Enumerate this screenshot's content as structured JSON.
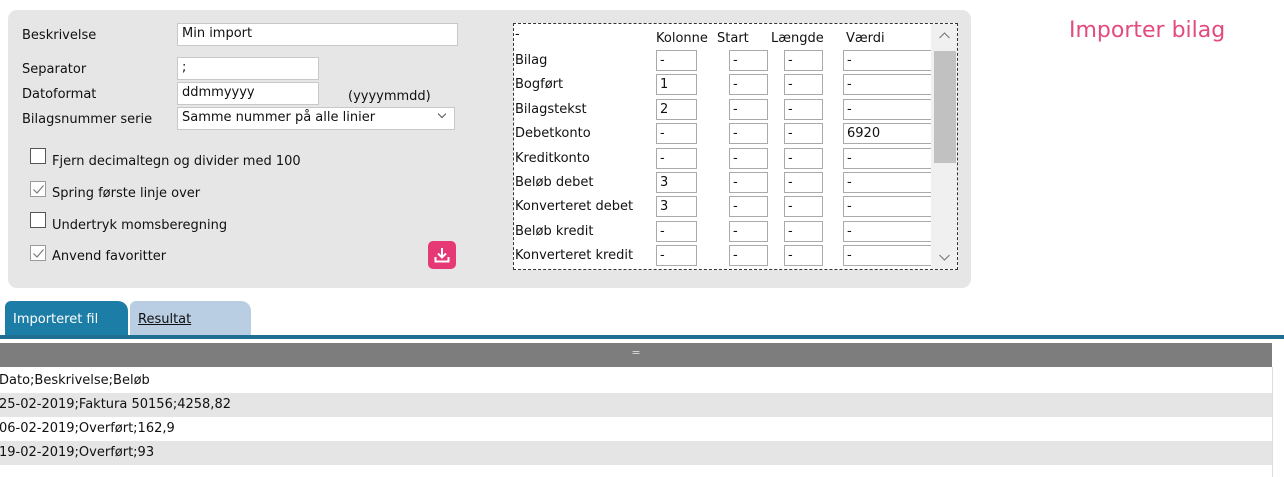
{
  "form": {
    "beskrivelse_label": "Beskrivelse",
    "beskrivelse_value": "Min import",
    "separator_label": "Separator",
    "separator_value": ";",
    "datoformat_label": "Datoformat",
    "datoformat_value": "ddmmyyyy",
    "datoformat_hint": "(yyyymmdd)",
    "serie_label": "Bilagsnummer serie",
    "serie_value": "Samme nummer på alle linier",
    "checkboxes": [
      {
        "label": "Fjern decimaltegn og divider med 100",
        "checked": false
      },
      {
        "label": "Spring første linje over",
        "checked": true
      },
      {
        "label": "Undertryk momsberegning",
        "checked": false
      },
      {
        "label": "Anvend favoritter",
        "checked": true
      }
    ]
  },
  "mapping": {
    "corner": "-",
    "headers": [
      "Kolonne",
      "Start",
      "Længde",
      "Værdi"
    ],
    "rows": [
      {
        "label": "Bilag",
        "kolonne": "-",
        "start": "-",
        "laengde": "-",
        "vaerdi": "-"
      },
      {
        "label": "Bogført",
        "kolonne": "1",
        "start": "-",
        "laengde": "-",
        "vaerdi": "-"
      },
      {
        "label": "Bilagstekst",
        "kolonne": "2",
        "start": "-",
        "laengde": "-",
        "vaerdi": "-"
      },
      {
        "label": "Debetkonto",
        "kolonne": "-",
        "start": "-",
        "laengde": "-",
        "vaerdi": "6920"
      },
      {
        "label": "Kreditkonto",
        "kolonne": "-",
        "start": "-",
        "laengde": "-",
        "vaerdi": "-"
      },
      {
        "label": "Beløb debet",
        "kolonne": "3",
        "start": "-",
        "laengde": "-",
        "vaerdi": "-"
      },
      {
        "label": "Konverteret debet",
        "kolonne": "3",
        "start": "-",
        "laengde": "-",
        "vaerdi": "-"
      },
      {
        "label": "Beløb kredit",
        "kolonne": "-",
        "start": "-",
        "laengde": "-",
        "vaerdi": "-"
      },
      {
        "label": "Konverteret kredit",
        "kolonne": "-",
        "start": "-",
        "laengde": "-",
        "vaerdi": "-"
      }
    ]
  },
  "page_title": "Importer bilag",
  "tabs": [
    {
      "label": "Importeret fil",
      "active": true
    },
    {
      "label": "Resultat",
      "active": false
    }
  ],
  "grid_header": "=",
  "file_lines": [
    "Dato;Beskrivelse;Beløb",
    "25-02-2019;Faktura 50156;4258,82",
    "06-02-2019;Overført;162,9",
    "19-02-2019;Overført;93"
  ],
  "icons": {
    "download": "download-icon",
    "checkmark": "checkmark-icon",
    "chevron": "chevron-down-icon",
    "scroll_up": "chevron-up-icon",
    "scroll_down": "chevron-down-icon"
  },
  "colors": {
    "accent_pink": "#e53875",
    "title_pink": "#e34a7f",
    "active_tab": "#1c7ea6",
    "inactive_tab": "#b9cde3",
    "panel_bg": "#e6e6e6"
  }
}
